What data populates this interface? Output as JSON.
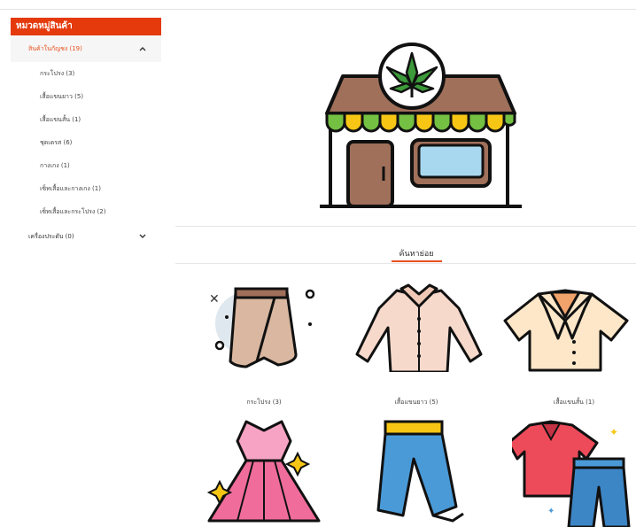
{
  "sidebar": {
    "title": "หมวดหมู่สินค้า",
    "main_categories": [
      {
        "label": "สินค้าในกัญชง (19)",
        "expanded": true
      },
      {
        "label": "เครื่องประดับ (0)",
        "expanded": false
      }
    ],
    "sub_items": [
      "กระโปรง (3)",
      "เสื้อแขนยาว (5)",
      "เสื้อแขนสั้น (1)",
      "ชุดเดรส (6)",
      "กางเกง (1)",
      "เซ็ทเสื้อและกางเกง (1)",
      "เซ็ทเสื้อและกระโปรง (2)"
    ]
  },
  "hero": {
    "icon": "cannabis-shop-icon"
  },
  "subcategory_section": {
    "title": "ค้นหาย่อย"
  },
  "products": [
    {
      "label": "กระโปรง (3)",
      "icon": "skirt-icon"
    },
    {
      "label": "เสื้อแขนยาว (5)",
      "icon": "long-sleeve-shirt-icon"
    },
    {
      "label": "เสื้อแขนสั้น (1)",
      "icon": "short-sleeve-shirt-icon"
    },
    {
      "label": "",
      "icon": "dress-icon"
    },
    {
      "label": "",
      "icon": "jeans-icon"
    },
    {
      "label": "",
      "icon": "shirt-and-pants-set-icon"
    }
  ],
  "colors": {
    "accent": "#e43a0c",
    "accent_text": "#e8501f"
  }
}
